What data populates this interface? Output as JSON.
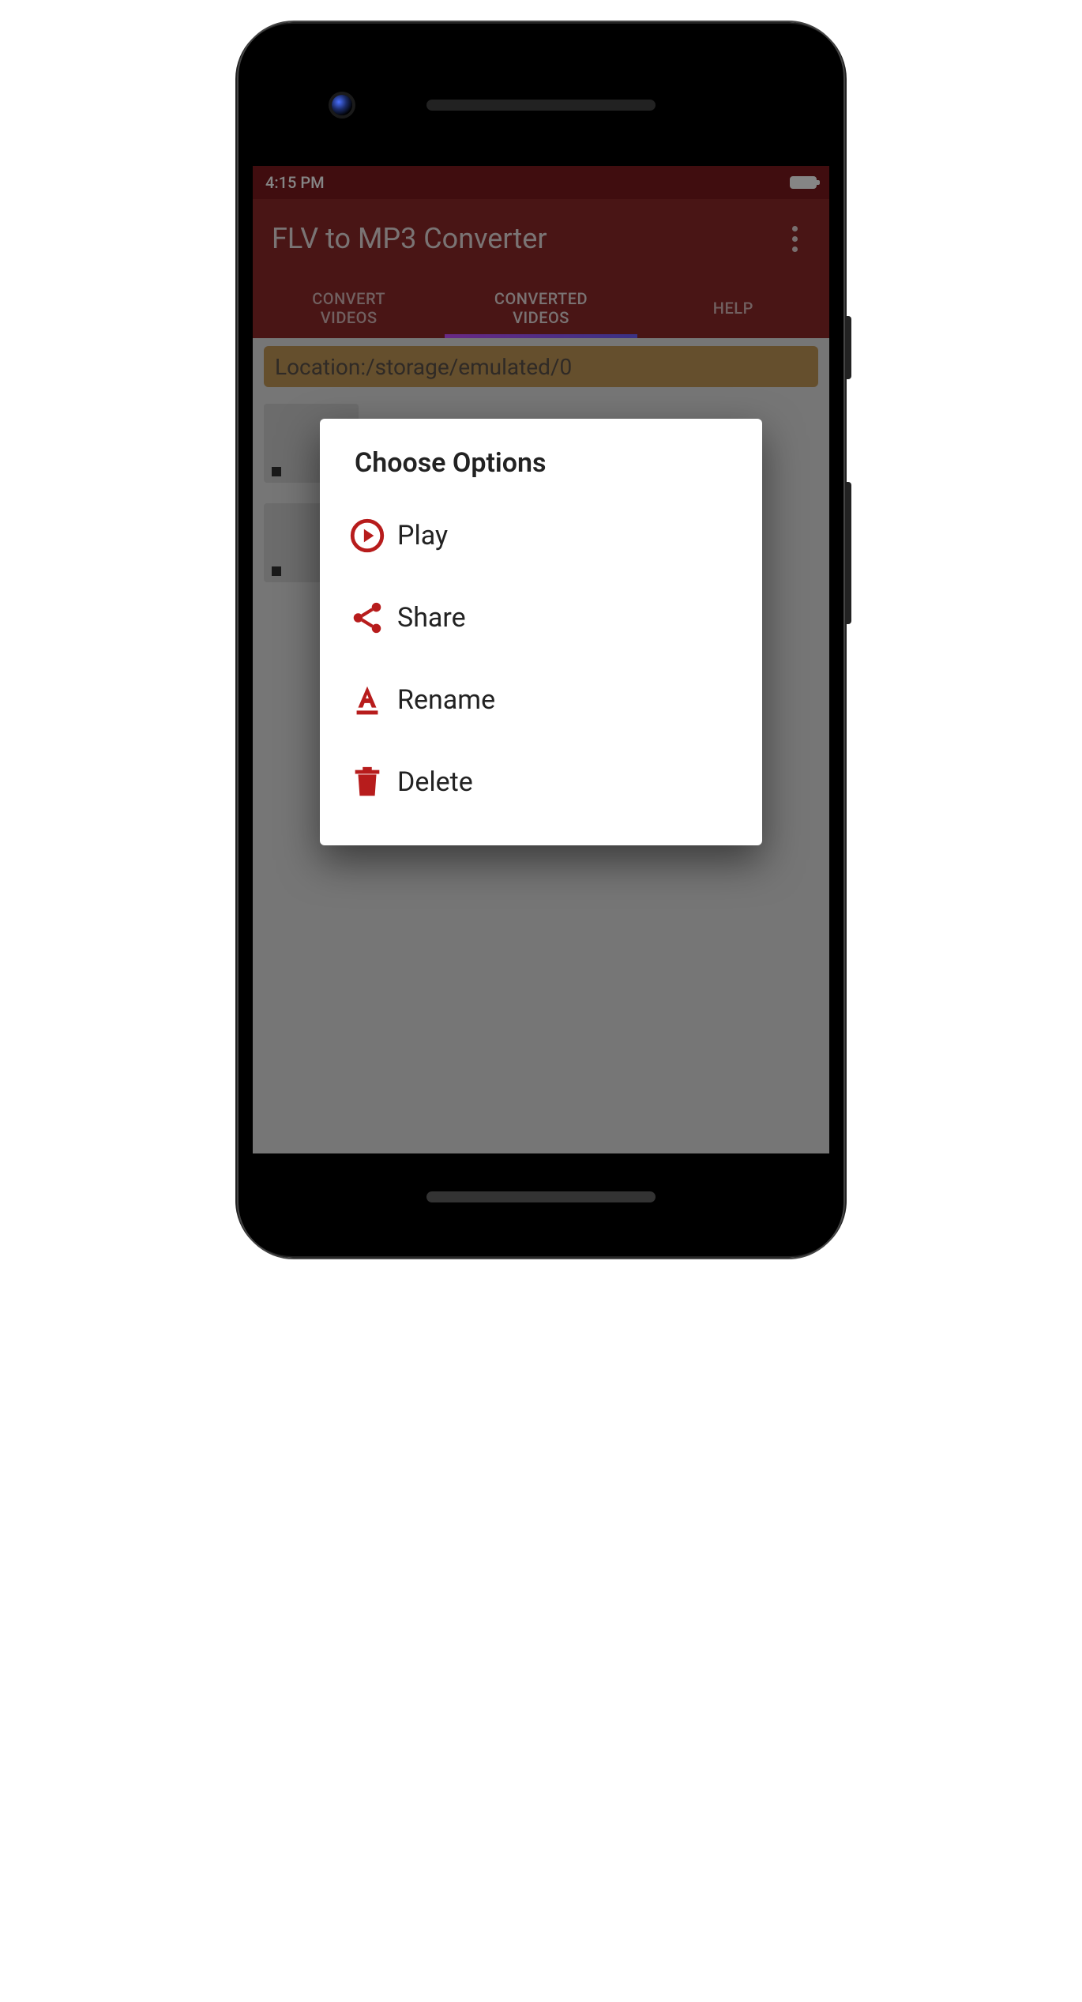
{
  "status": {
    "time": "4:15 PM"
  },
  "appbar": {
    "title": "FLV to MP3 Converter"
  },
  "tabs": {
    "items": [
      {
        "line1": "CONVERT",
        "line2": "VIDEOS"
      },
      {
        "line1": "CONVERTED",
        "line2": "VIDEOS"
      },
      {
        "line1": "HELP",
        "line2": ""
      }
    ],
    "active_index": 1
  },
  "location": "Location:/storage/emulated/0",
  "dialog": {
    "title": "Choose Options",
    "options": {
      "play": "Play",
      "share": "Share",
      "rename": "Rename",
      "delete": "Delete"
    }
  },
  "colors": {
    "primary_dark": "#7b1a1e",
    "primary": "#8c2a2a",
    "accent": "#b71c1c"
  }
}
